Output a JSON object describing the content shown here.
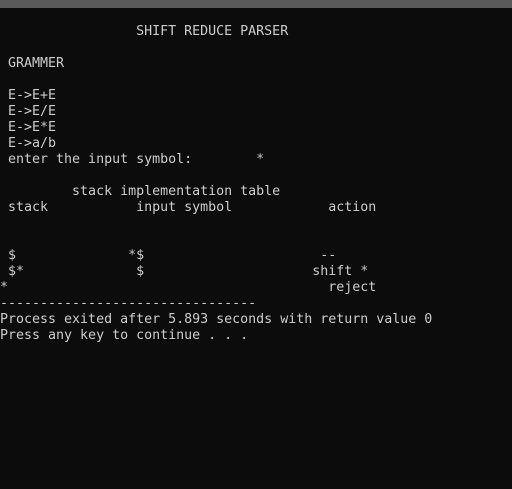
{
  "terminal": {
    "colors": {
      "background": "#0c0c0c",
      "text": "#cccccc",
      "titlebar": "#5a5a5a"
    },
    "title": "                 SHIFT REDUCE PARSER",
    "grammar_heading": " GRAMMER",
    "productions": [
      " E->E+E",
      " E->E/E",
      " E->E*E",
      " E->a/b"
    ],
    "input_prompt": " enter the input symbol:        *",
    "table_title": "         stack implementation table",
    "table_header": " stack           input symbol            action",
    "table_rows": [
      " $              *$                      --",
      " $*              $                     shift *",
      "*                                        reject"
    ],
    "separator": "--------------------------------",
    "exit_message": "Process exited after 5.893 seconds with return value 0",
    "continue_prompt": "Press any key to continue . . ."
  }
}
